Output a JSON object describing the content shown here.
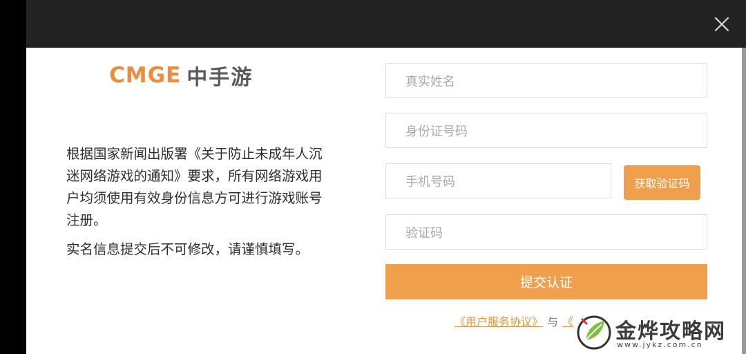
{
  "colors": {
    "accent": "#f0a04d",
    "logo_orange": "#ec8c3c",
    "top_bar": "#232323",
    "panel": "#ffffff",
    "body_text": "#2e2e2e",
    "placeholder": "#a9a9a9"
  },
  "dialog": {
    "close_icon": "close-icon"
  },
  "logo": {
    "latin": "CMGE",
    "chinese": "中手游"
  },
  "notice": {
    "paragraph1": "根据国家新闻出版署《关于防止未成年人沉迷网络游戏的通知》要求，所有网络游戏用户均须使用有效身份信息方可进行游戏账号注册。",
    "paragraph2": "实名信息提交后不可修改，请谨慎填写。"
  },
  "form": {
    "name_placeholder": "真实姓名",
    "id_placeholder": "身份证号码",
    "phone_placeholder": "手机号码",
    "code_placeholder": "验证码",
    "get_code_label": "获取验证码",
    "submit_label": "提交认证"
  },
  "agreement": {
    "link1": "《用户服务协议》",
    "connector": "与",
    "link2_visible": "《"
  },
  "watermark": {
    "title": "金烨攻略网",
    "url": "www.jykz.com.cn",
    "icon": "leaf-icon"
  }
}
